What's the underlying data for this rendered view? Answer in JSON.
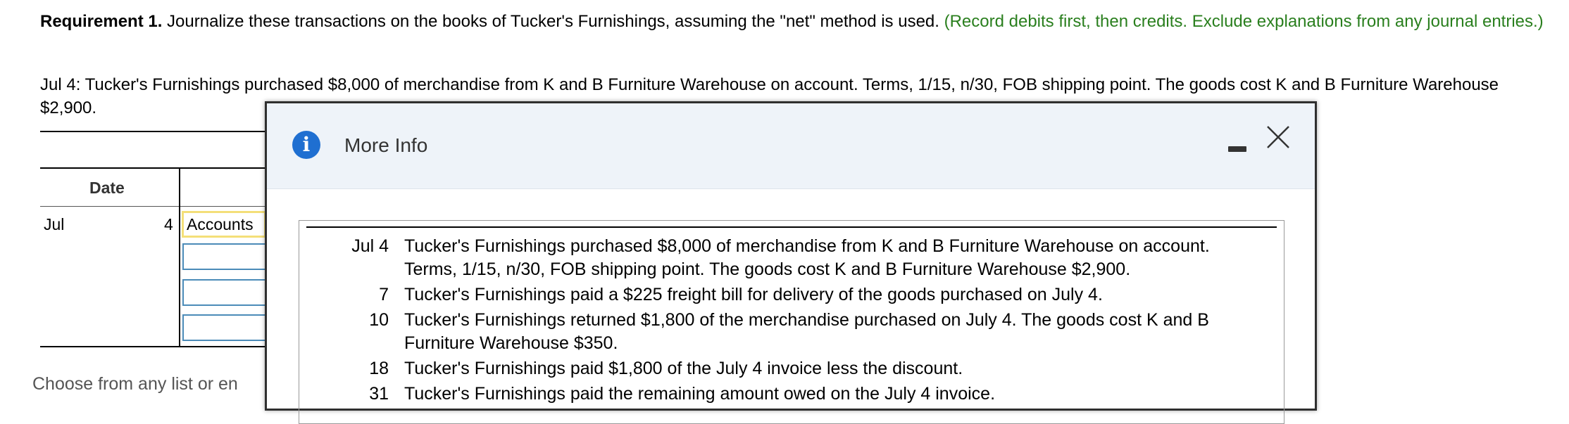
{
  "requirement": {
    "label": "Requirement 1.",
    "text": " Journalize these transactions on the books of Tucker's Furnishings, assuming the \"net\" method is used. ",
    "instruction": "(Record debits first, then credits. Exclude explanations from any journal entries.)"
  },
  "transaction_prompt": "Jul 4: Tucker's Furnishings purchased $8,000 of merchandise from K and B Furniture Warehouse on account. Terms, 1/15, n/30, FOB shipping point. The goods cost K and B Furniture Warehouse $2,900.",
  "journal": {
    "date_header": "Date",
    "month": "Jul",
    "day": "4",
    "account_value": "Accounts"
  },
  "footer_hint": "Choose from any list or en",
  "modal": {
    "title": "More Info",
    "info_icon_glyph": "i",
    "transactions": [
      {
        "date": "Jul 4",
        "text": "Tucker's Furnishings purchased $8,000 of merchandise from K and B Furniture Warehouse on account. Terms, 1/15, n/30, FOB shipping point. The goods cost K and B Furniture Warehouse $2,900."
      },
      {
        "date": "7",
        "text": "Tucker's Furnishings paid a $225 freight bill for delivery of the goods purchased on July 4."
      },
      {
        "date": "10",
        "text": "Tucker's Furnishings returned $1,800 of the merchandise purchased on July 4. The goods cost K and B Furniture Warehouse $350."
      },
      {
        "date": "18",
        "text": "Tucker's Furnishings paid $1,800 of the July 4 invoice less the discount."
      },
      {
        "date": "31",
        "text": "Tucker's Furnishings paid the remaining amount owed on the July 4 invoice."
      }
    ]
  },
  "colors": {
    "instruction_green": "#2a7f1e",
    "info_icon_blue": "#1f6fd1",
    "modal_header_bg": "#eef3f9",
    "selected_cell_border": "#f4df79",
    "input_border": "#4b8bb8"
  }
}
